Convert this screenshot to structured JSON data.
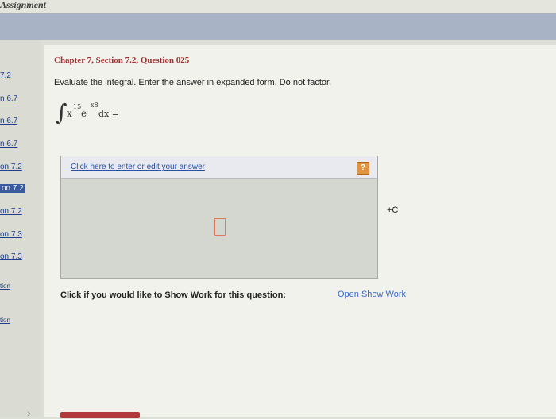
{
  "window": {
    "title": "Assignment"
  },
  "sidebar": {
    "items": [
      {
        "label": "7.2"
      },
      {
        "label": "n 6.7"
      },
      {
        "label": "n 6.7"
      },
      {
        "label": "n 6.7"
      },
      {
        "label": "on 7.2"
      },
      {
        "label": "on 7.2",
        "active": true
      },
      {
        "label": "on 7.2"
      },
      {
        "label": "on 7.3"
      },
      {
        "label": "on 7.3"
      },
      {
        "label": "tion"
      },
      {
        "label": "tion"
      }
    ]
  },
  "question": {
    "header": "Chapter 7, Section 7.2, Question 025",
    "prompt": "Evaluate the integral. Enter the answer in expanded form. Do not factor.",
    "integral": {
      "sign": "∫",
      "x": "x",
      "x_exp": "15",
      "e": "e",
      "e_exp": "x8",
      "rest": "dx ="
    }
  },
  "answer": {
    "link_text": "Click here to enter or edit your answer",
    "help_icon": "question-icon",
    "help_glyph": "?",
    "suffix": "+C"
  },
  "show_work": {
    "label": "Click if you would like to Show Work for this question:",
    "link": "Open Show Work"
  },
  "colors": {
    "chapter": "#a03030",
    "link": "#2a4fa0",
    "band": "#a8b4c6",
    "help": "#e09440"
  }
}
